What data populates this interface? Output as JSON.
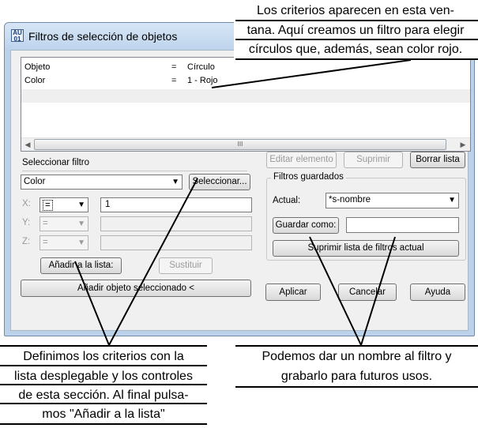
{
  "window": {
    "title": "Filtros de selección de objetos",
    "icon_name": "app-icon"
  },
  "criteria": {
    "rows": [
      {
        "object": "Objeto",
        "op": "=",
        "value": "Círculo"
      },
      {
        "object": "Color",
        "op": "=",
        "value": "1 - Rojo"
      }
    ],
    "scroll_thumb_label": "III"
  },
  "select_filter": {
    "heading": "Seleccionar filtro",
    "type_value": "Color",
    "select_button": "Seleccionar...",
    "x_label": "X:",
    "x_op": "=",
    "x_value": "1",
    "y_label": "Y:",
    "y_op": "=",
    "z_label": "Z:",
    "z_op": "=",
    "add_to_list": "Añadir a la lista:",
    "substitute": "Sustituir",
    "add_selected": "Añadir objeto seleccionado <"
  },
  "edit": {
    "edit_item": "Editar elemento",
    "delete": "Suprimir",
    "clear_list": "Borrar lista"
  },
  "saved_filters": {
    "heading": "Filtros guardados",
    "current_label": "Actual:",
    "current_value": "*s-nombre",
    "save_as": "Guardar como:",
    "save_as_value": "",
    "delete_current": "Suprimir lista de filtros actual"
  },
  "bottom": {
    "apply": "Aplicar",
    "cancel": "Cancelar",
    "help": "Ayuda"
  },
  "annotations": {
    "top": [
      "Los criterios aparecen en esta ven-",
      "tana. Aquí creamos un filtro para elegir",
      "círculos que, además, sean color rojo."
    ],
    "bottom_left": [
      "Definimos los criterios con la",
      "lista desplegable y los controles",
      "de esta sección. Al final pulsa-",
      "mos \"Añadir a la lista\""
    ],
    "bottom_right": [
      "Podemos dar un nombre al filtro y",
      "grabarlo para futuros usos."
    ]
  }
}
